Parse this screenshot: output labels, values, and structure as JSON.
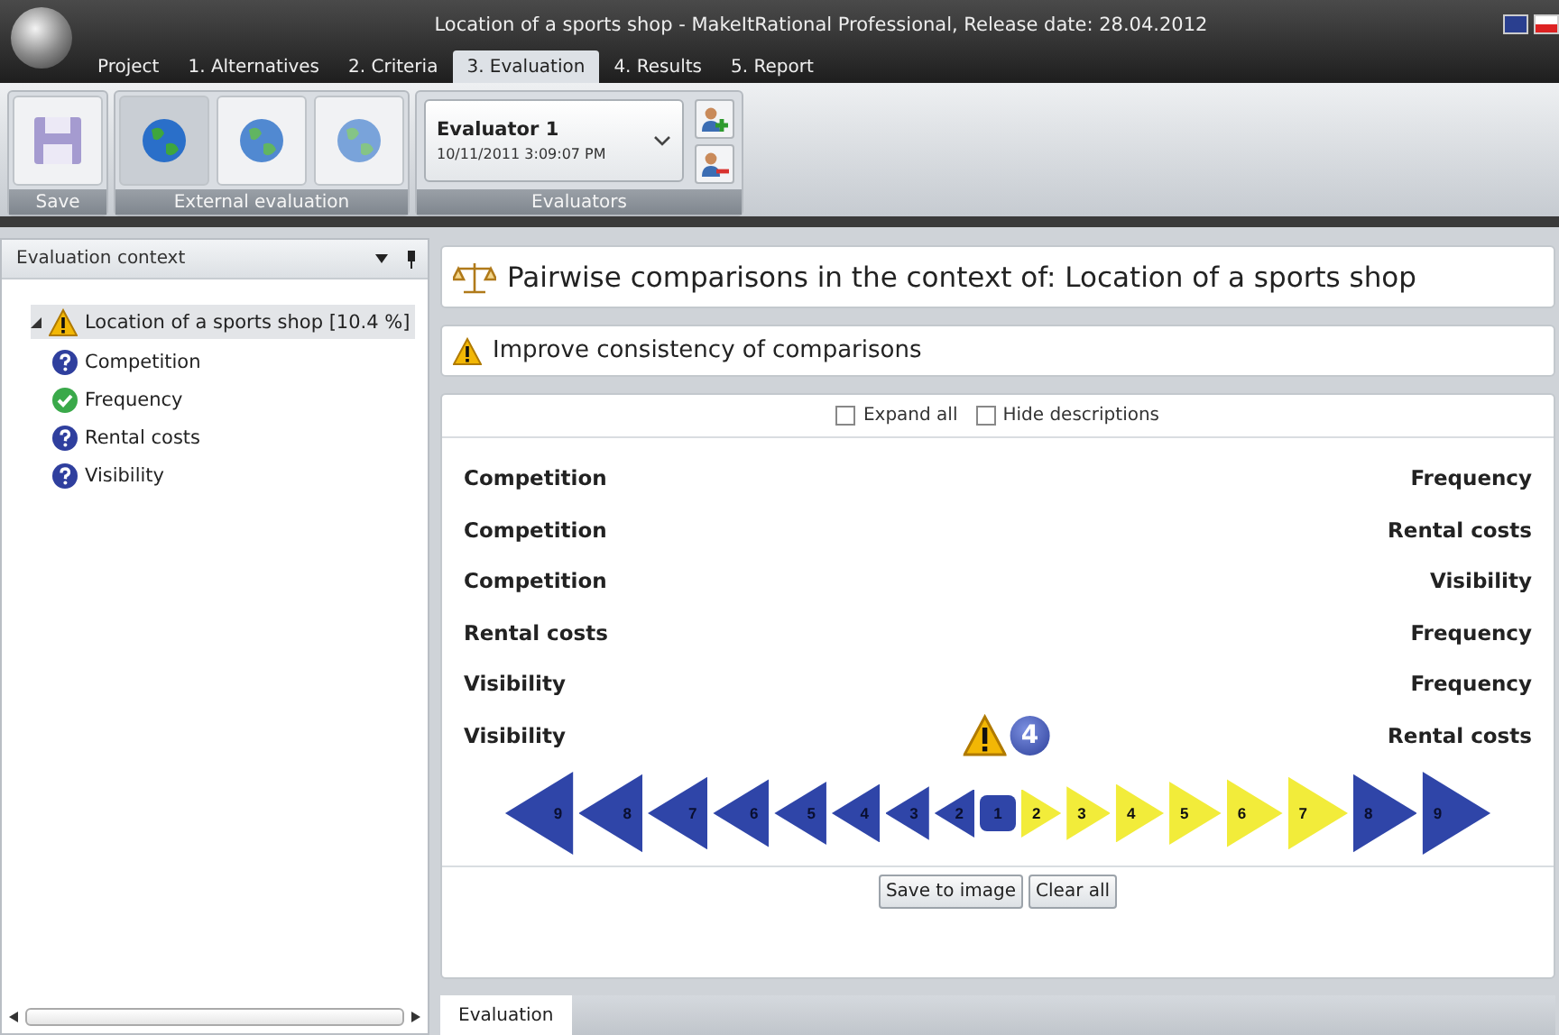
{
  "window": {
    "title": "Location of a sports shop - MakeItRational Professional, Release date: 28.04.2012"
  },
  "menu_tabs": [
    {
      "label": "Project",
      "selected": false
    },
    {
      "label": "1. Alternatives",
      "selected": false
    },
    {
      "label": "2. Criteria",
      "selected": false
    },
    {
      "label": "3. Evaluation",
      "selected": true
    },
    {
      "label": "4. Results",
      "selected": false
    },
    {
      "label": "5. Report",
      "selected": false
    }
  ],
  "ribbon": {
    "groups": [
      {
        "label": "Save",
        "kind": "save"
      },
      {
        "label": "External evaluation",
        "kind": "external"
      },
      {
        "label": "Evaluators",
        "kind": "evaluators"
      }
    ],
    "evaluator": {
      "name": "Evaluator 1",
      "date": "10/11/2011 3:09:07 PM"
    }
  },
  "context_panel": {
    "title": "Evaluation context",
    "tree": [
      {
        "label": "Location of a sports shop [10.4 %]",
        "kind": "warning",
        "expanded": true,
        "selected": true,
        "children": [
          {
            "label": "Competition",
            "kind": "question",
            "selected": false
          },
          {
            "label": "Frequency",
            "kind": "check",
            "selected": false
          },
          {
            "label": "Rental costs",
            "kind": "question",
            "selected": false
          },
          {
            "label": "Visibility",
            "kind": "question",
            "selected": false
          }
        ]
      }
    ]
  },
  "heading": "Pairwise comparisons in the context of: Location of a sports shop",
  "warning": "Improve consistency of comparisons",
  "options": [
    {
      "label": "Expand all",
      "checked": false
    },
    {
      "label": "Hide descriptions",
      "checked": false
    }
  ],
  "pairs": [
    {
      "left": "Competition",
      "right": "Frequency"
    },
    {
      "left": "Competition",
      "right": "Rental costs"
    },
    {
      "left": "Competition",
      "right": "Visibility"
    },
    {
      "left": "Rental costs",
      "right": "Frequency"
    },
    {
      "left": "Visibility",
      "right": "Frequency"
    },
    {
      "left": "Visibility",
      "right": "Rental costs",
      "badge": "4"
    }
  ],
  "scale": [
    {
      "label": "9",
      "kind": "left",
      "selected": false
    },
    {
      "label": "8",
      "kind": "left",
      "selected": false
    },
    {
      "label": "7",
      "kind": "left",
      "selected": false
    },
    {
      "label": "6",
      "kind": "left",
      "selected": false
    },
    {
      "label": "5",
      "kind": "left",
      "selected": false
    },
    {
      "label": "4",
      "kind": "left",
      "selected": false
    },
    {
      "label": "3",
      "kind": "left",
      "selected": false
    },
    {
      "label": "2",
      "kind": "left",
      "selected": false
    },
    {
      "label": "1",
      "kind": "center",
      "selected": false
    },
    {
      "label": "2",
      "kind": "right",
      "selected": true
    },
    {
      "label": "3",
      "kind": "right",
      "selected": true
    },
    {
      "label": "4",
      "kind": "right",
      "selected": true
    },
    {
      "label": "5",
      "kind": "right",
      "selected": true
    },
    {
      "label": "6",
      "kind": "right",
      "selected": true
    },
    {
      "label": "7",
      "kind": "right",
      "selected": true
    },
    {
      "label": "8",
      "kind": "right",
      "selected": false
    },
    {
      "label": "9",
      "kind": "right",
      "selected": false
    }
  ],
  "buttons": [
    "Save to image",
    "Clear all"
  ],
  "bottom_tabs": [
    {
      "label": "Evaluation",
      "selected": true
    }
  ]
}
